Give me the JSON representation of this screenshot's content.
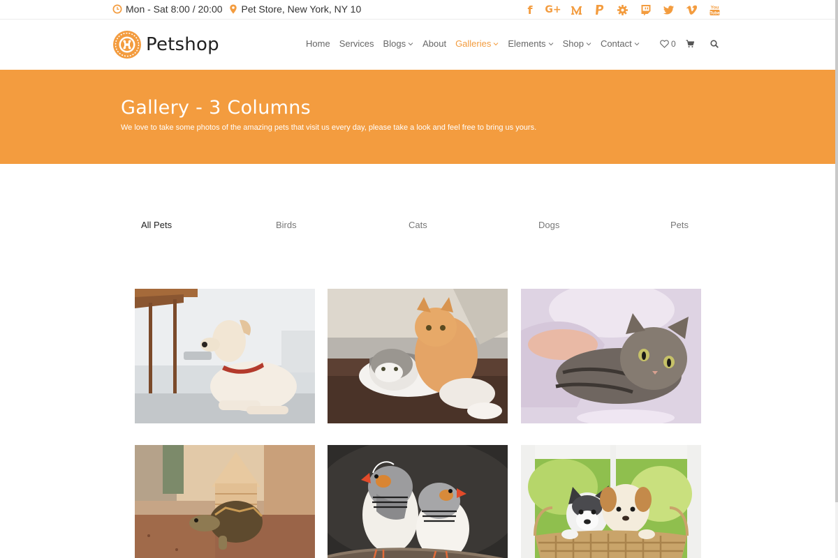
{
  "topbar": {
    "hours": "Mon - Sat 8:00 / 20:00",
    "address": "Pet Store, New York, NY 10",
    "social_icons": [
      "facebook-icon",
      "google-plus-icon",
      "medium-icon",
      "paypal-icon",
      "gear-icon",
      "twitch-icon",
      "twitter-icon",
      "vimeo-icon",
      "youtube-icon"
    ]
  },
  "header": {
    "logo": "Petshop",
    "nav": [
      {
        "label": "Home"
      },
      {
        "label": "Services"
      },
      {
        "label": "Blogs"
      },
      {
        "label": "About"
      },
      {
        "label": "Galleries"
      },
      {
        "label": "Elements"
      },
      {
        "label": "Shop"
      },
      {
        "label": "Contact"
      }
    ],
    "wishlist_count": "0"
  },
  "banner": {
    "title": "Gallery - 3 Columns",
    "subtitle": "We love to take some photos of the amazing pets that visit us every day, please take a look and feel free to bring us yours."
  },
  "filters": [
    "All Pets",
    "Birds",
    "Cats",
    "Dogs",
    "Pets"
  ],
  "gallery": [
    {
      "subject": "dog"
    },
    {
      "subject": "two cats"
    },
    {
      "subject": "tabby cat"
    },
    {
      "subject": "tortoise"
    },
    {
      "subject": "finches"
    },
    {
      "subject": "puppies in basket"
    }
  ],
  "colors": {
    "accent": "#f39c3f"
  }
}
